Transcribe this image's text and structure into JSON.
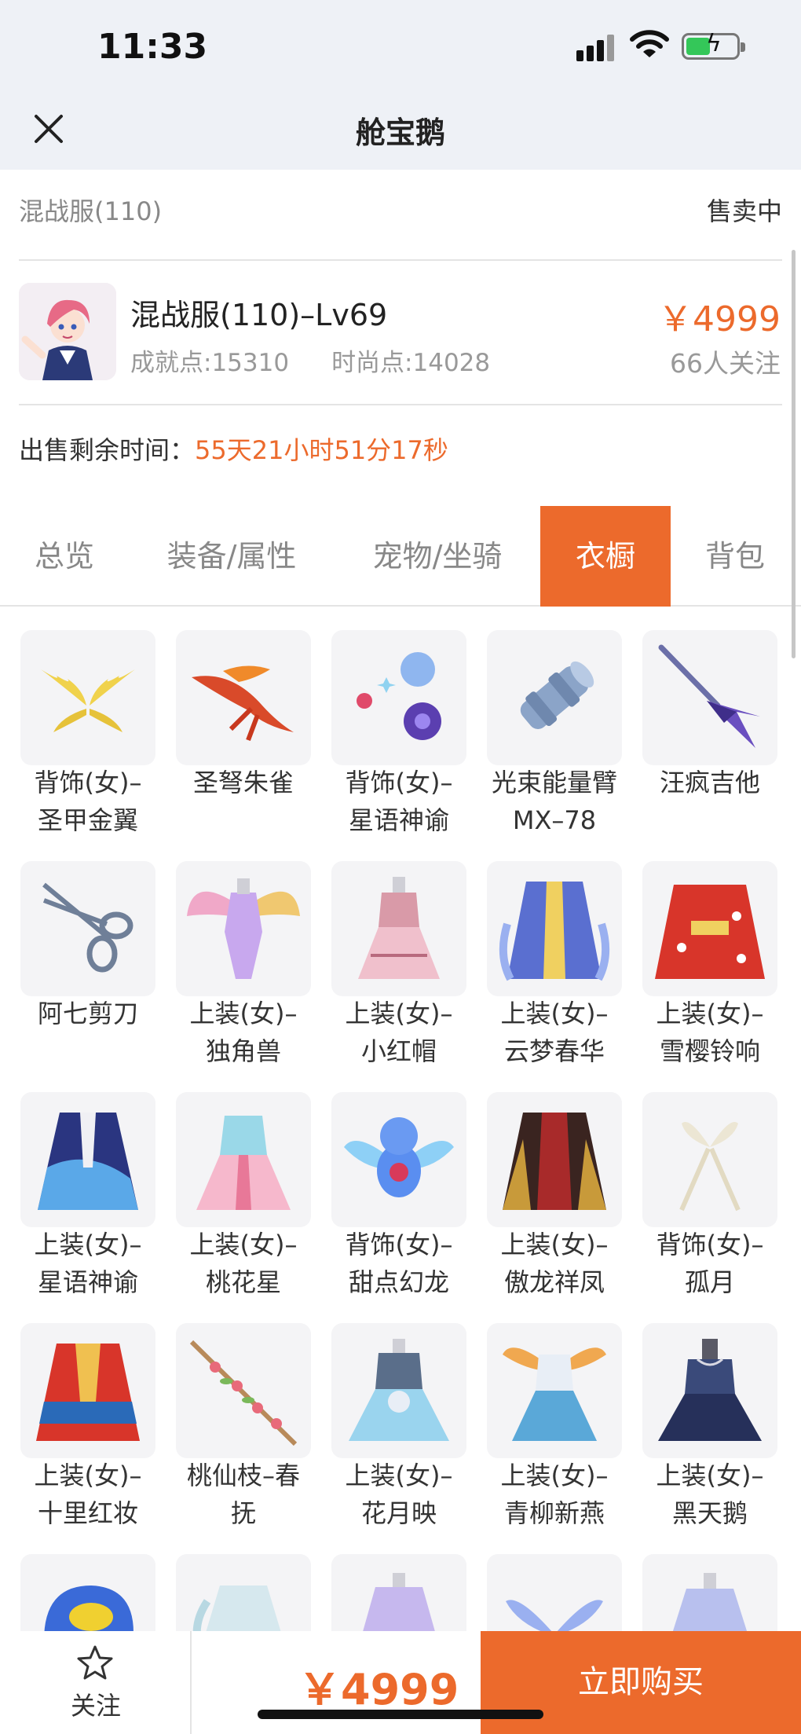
{
  "status_bar": {
    "time": "11:33"
  },
  "nav": {
    "title": "舱宝鹅"
  },
  "header": {
    "server": "混战服(110)",
    "sale_status": "售卖中",
    "item_title": "混战服(110)–Lv69",
    "achievement": "成就点:15310",
    "fashion": "时尚点:14028",
    "price": "￥4999",
    "watchers": "66人关注",
    "remaining_label": "出售剩余时间：",
    "remaining_value": "55天21小时51分17秒"
  },
  "tabs": [
    {
      "label": "总览",
      "active": false
    },
    {
      "label": "装备/属性",
      "active": false
    },
    {
      "label": "宠物/坐骑",
      "active": false
    },
    {
      "label": "衣橱",
      "active": true
    },
    {
      "label": "背包",
      "active": false
    }
  ],
  "wardrobe": [
    {
      "line1": "背饰(女)–",
      "line2": "圣甲金翼",
      "icon": "golden-wings-icon"
    },
    {
      "line1": "圣弩朱雀",
      "line2": "",
      "icon": "phoenix-crossbow-icon"
    },
    {
      "line1": "背饰(女)–",
      "line2": "星语神谕",
      "icon": "orbs-icon"
    },
    {
      "line1": "光束能量臂",
      "line2": "MX–78",
      "icon": "beam-cannon-icon"
    },
    {
      "line1": "汪疯吉他",
      "line2": "",
      "icon": "guitar-icon"
    },
    {
      "line1": "阿七剪刀",
      "line2": "",
      "icon": "scissors-icon"
    },
    {
      "line1": "上装(女)–",
      "line2": "独角兽",
      "icon": "unicorn-dress-icon"
    },
    {
      "line1": "上装(女)–",
      "line2": "小红帽",
      "icon": "red-hood-dress-icon"
    },
    {
      "line1": "上装(女)–",
      "line2": "云梦春华",
      "icon": "blue-robe-icon"
    },
    {
      "line1": "上装(女)–",
      "line2": "雪樱铃响",
      "icon": "red-kimono-icon"
    },
    {
      "line1": "上装(女)–",
      "line2": "星语神谕",
      "icon": "star-robe-icon"
    },
    {
      "line1": "上装(女)–",
      "line2": "桃花星",
      "icon": "peach-dress-icon"
    },
    {
      "line1": "背饰(女)–",
      "line2": "甜点幻龙",
      "icon": "dragon-icon"
    },
    {
      "line1": "上装(女)–",
      "line2": "傲龙祥凤",
      "icon": "dark-robe-icon"
    },
    {
      "line1": "背饰(女)–",
      "line2": "孤月",
      "icon": "ribbon-icon"
    },
    {
      "line1": "上装(女)–",
      "line2": "十里红妆",
      "icon": "bridal-robe-icon"
    },
    {
      "line1": "桃仙枝–春",
      "line2": "抚",
      "icon": "peach-branch-icon"
    },
    {
      "line1": "上装(女)–",
      "line2": "花月映",
      "icon": "flower-dress-icon"
    },
    {
      "line1": "上装(女)–",
      "line2": "青柳新燕",
      "icon": "willow-dress-icon"
    },
    {
      "line1": "上装(女)–",
      "line2": "黑天鹅",
      "icon": "black-swan-dress-icon"
    },
    {
      "line1": "",
      "line2": "",
      "icon": "cap-icon"
    },
    {
      "line1": "",
      "line2": "",
      "icon": "white-dress-icon"
    },
    {
      "line1": "",
      "line2": "",
      "icon": "lavender-dress-icon"
    },
    {
      "line1": "",
      "line2": "",
      "icon": "blue-wings-icon"
    },
    {
      "line1": "",
      "line2": "",
      "icon": "gown-icon"
    }
  ],
  "bottom_bar": {
    "follow_label": "关注",
    "price": "￥4999",
    "buy_label": "立即购买"
  },
  "colors": {
    "accent": "#ec6a2c"
  }
}
